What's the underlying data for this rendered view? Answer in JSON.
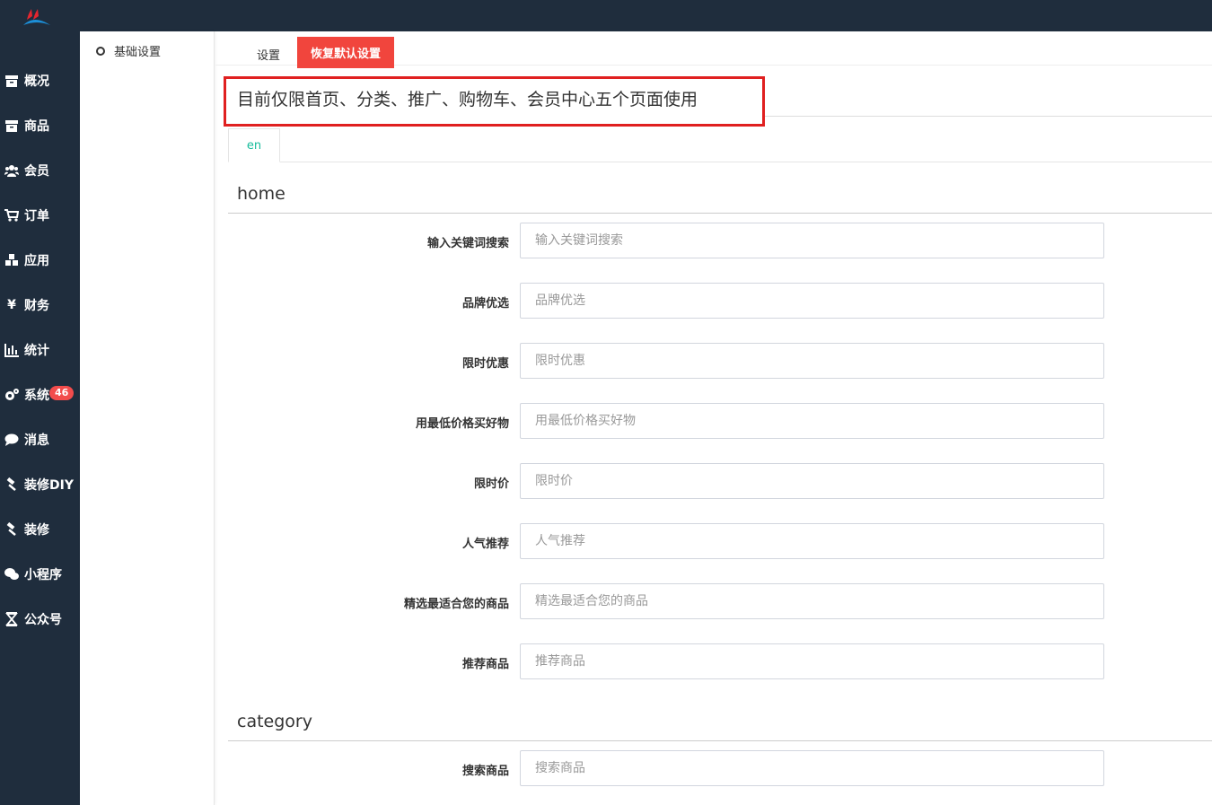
{
  "sidebar": {
    "items": [
      {
        "label": "概况",
        "icon": "archive-icon"
      },
      {
        "label": "商品",
        "icon": "archive-icon"
      },
      {
        "label": "会员",
        "icon": "users-icon"
      },
      {
        "label": "订单",
        "icon": "cart-icon"
      },
      {
        "label": "应用",
        "icon": "cubes-icon"
      },
      {
        "label": "财务",
        "icon": "yen-icon"
      },
      {
        "label": "统计",
        "icon": "bar-chart-icon"
      },
      {
        "label": "系统",
        "icon": "gears-icon"
      },
      {
        "label": "消息",
        "icon": "comment-icon"
      },
      {
        "label": "装修DIY",
        "icon": "gavel-icon"
      },
      {
        "label": "装修",
        "icon": "gavel-icon"
      },
      {
        "label": "小程序",
        "icon": "wechat-icon"
      },
      {
        "label": "公众号",
        "icon": "hourglass-icon"
      }
    ],
    "message_badge": "46"
  },
  "subnav": {
    "item": "基础设置"
  },
  "toolbar": {
    "settings_tab": "设置",
    "restore_button": "恢复默认设置"
  },
  "notice": "目前仅限首页、分类、推广、购物车、会员中心五个页面使用",
  "lang_tab": "en",
  "sections": {
    "home": {
      "title": "home",
      "fields": [
        {
          "label": "输入关键词搜索",
          "placeholder": "输入关键词搜索"
        },
        {
          "label": "品牌优选",
          "placeholder": "品牌优选"
        },
        {
          "label": "限时优惠",
          "placeholder": "限时优惠"
        },
        {
          "label": "用最低价格买好物",
          "placeholder": "用最低价格买好物"
        },
        {
          "label": "限时价",
          "placeholder": "限时价"
        },
        {
          "label": "人气推荐",
          "placeholder": "人气推荐"
        },
        {
          "label": "精选最适合您的商品",
          "placeholder": "精选最适合您的商品"
        },
        {
          "label": "推荐商品",
          "placeholder": "推荐商品"
        }
      ]
    },
    "category": {
      "title": "category",
      "fields": [
        {
          "label": "搜索商品",
          "placeholder": "搜索商品"
        }
      ]
    }
  },
  "colors": {
    "sidebar": "#1f2d3d",
    "accent_red": "#f1453d",
    "tab_green": "#18bc9c"
  }
}
